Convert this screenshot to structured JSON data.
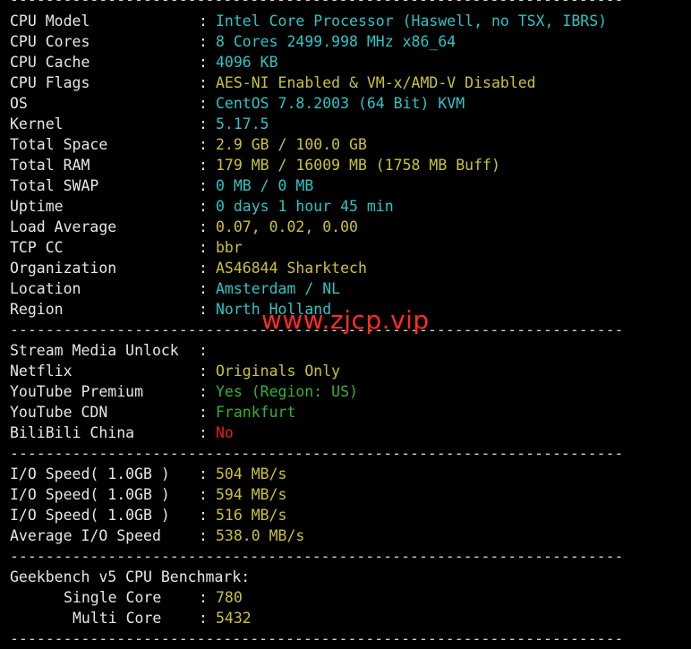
{
  "separator": "---------------------------------------------------------------------",
  "system": [
    {
      "label": "CPU Model",
      "value": "Intel Core Processor (Haswell, no TSX, IBRS)",
      "color": "cyan"
    },
    {
      "label": "CPU Cores",
      "value": "8 Cores 2499.998 MHz x86_64",
      "color": "cyan"
    },
    {
      "label": "CPU Cache",
      "value": "4096 KB",
      "color": "cyan"
    },
    {
      "label": "CPU Flags",
      "value": "AES-NI Enabled & VM-x/AMD-V Disabled",
      "color": "yellow"
    },
    {
      "label": "OS",
      "value": "CentOS 7.8.2003 (64 Bit) KVM",
      "color": "cyan"
    },
    {
      "label": "Kernel",
      "value": "5.17.5",
      "color": "cyan"
    },
    {
      "label": "Total Space",
      "value": "2.9 GB / 100.0 GB",
      "color": "yellow"
    },
    {
      "label": "Total RAM",
      "value": "179 MB / 16009 MB (1758 MB Buff)",
      "color": "yellow"
    },
    {
      "label": "Total SWAP",
      "value": "0 MB / 0 MB",
      "color": "cyan"
    },
    {
      "label": "Uptime",
      "value": "0 days 1 hour 45 min",
      "color": "cyan"
    },
    {
      "label": "Load Average",
      "value": "0.07, 0.02, 0.00",
      "color": "yellow"
    },
    {
      "label": "TCP CC",
      "value": "bbr",
      "color": "yellow"
    },
    {
      "label": "Organization",
      "value": "AS46844 Sharktech",
      "color": "yellow"
    },
    {
      "label": "Location",
      "value": "Amsterdam / NL",
      "color": "cyan"
    },
    {
      "label": "Region",
      "value": "North Holland",
      "color": "cyan"
    }
  ],
  "watermark": "www.zjcp.vip",
  "stream": {
    "header": "Stream Media Unlock",
    "items": [
      {
        "label": "Netflix",
        "value": "Originals Only",
        "color": "yellow"
      },
      {
        "label": "YouTube Premium",
        "value": "Yes (Region: US)",
        "color": "green"
      },
      {
        "label": "YouTube CDN",
        "value": "Frankfurt",
        "color": "green"
      },
      {
        "label": "BiliBili China",
        "value": "No",
        "color": "red"
      }
    ]
  },
  "io": [
    {
      "label": "I/O Speed( 1.0GB )",
      "value": "504 MB/s",
      "color": "yellow"
    },
    {
      "label": "I/O Speed( 1.0GB )",
      "value": "594 MB/s",
      "color": "yellow"
    },
    {
      "label": "I/O Speed( 1.0GB )",
      "value": "516 MB/s",
      "color": "yellow"
    },
    {
      "label": "Average I/O Speed",
      "value": "538.0 MB/s",
      "color": "yellow"
    }
  ],
  "geekbench": {
    "header": "Geekbench v5 CPU Benchmark:",
    "single_label": "Single Core",
    "single_value": "780",
    "multi_label": "Multi Core",
    "multi_value": "5432",
    "value_color": "yellow"
  },
  "colon": ":"
}
